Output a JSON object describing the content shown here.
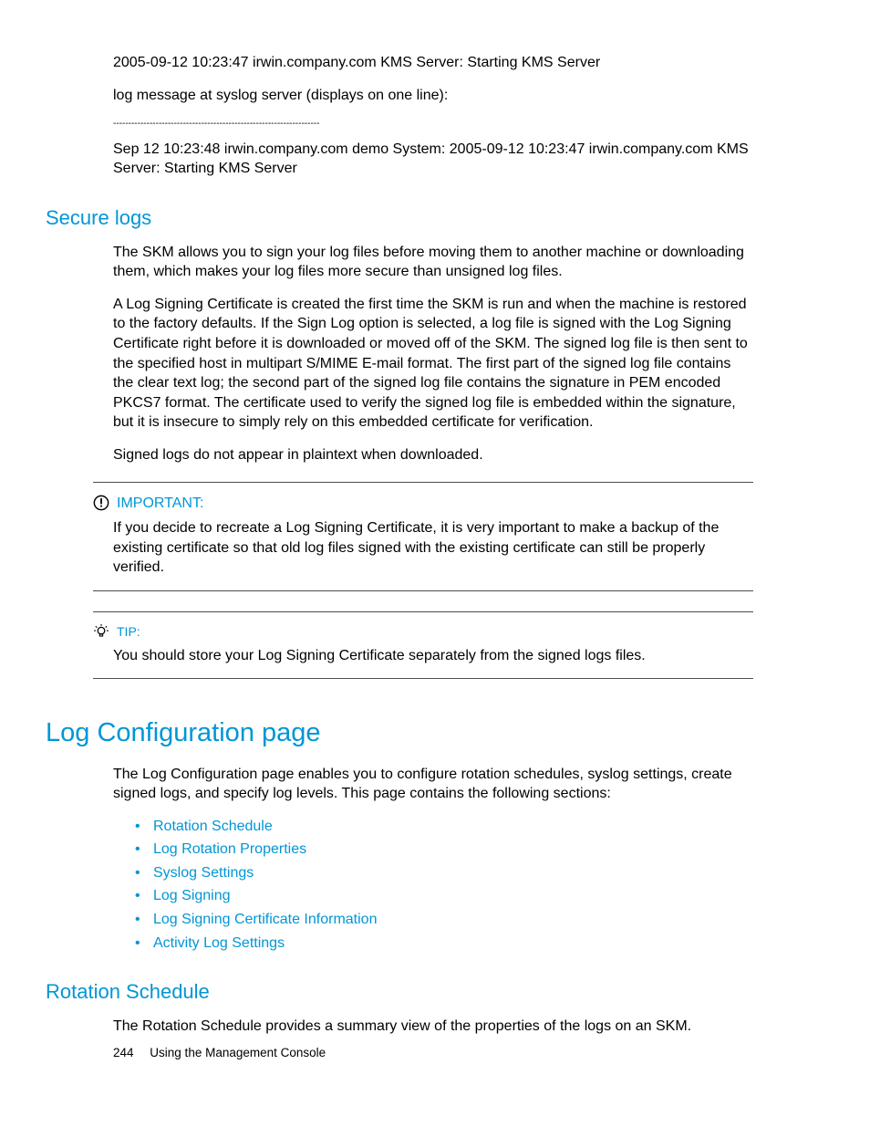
{
  "topBlock": {
    "line1": "2005-09-12 10:23:47 irwin.company.com KMS Server: Starting KMS Server",
    "line2": "log message at syslog server (displays on one line):",
    "sep": "--------------------------------------------------------------------",
    "line3": "Sep 12 10:23:48 irwin.company.com demo System: 2005-09-12 10:23:47 irwin.company.com KMS Server: Starting KMS Server"
  },
  "secureLogs": {
    "heading": "Secure logs",
    "p1": "The SKM allows you to sign your log files before moving them to another machine or downloading them, which makes your log files more secure than unsigned log files.",
    "p2": "A Log Signing Certificate is created the first time the SKM is run and when the machine is restored to the factory defaults. If the Sign Log option is selected, a log file is signed with the Log Signing Certificate right before it is downloaded or moved off of the SKM. The signed log file is then sent to the specified host in multipart  S/MIME E-mail format. The first part of the signed log file contains the clear text log; the second part of the signed log file contains the signature in PEM encoded PKCS7 format. The certificate used to verify the signed log file is embedded within the signature, but it is insecure to simply rely on this embedded certificate for verification.",
    "p3": "Signed logs do not appear in plaintext when downloaded."
  },
  "important": {
    "label": "IMPORTANT:",
    "body": "If you decide to recreate a Log Signing Certificate, it is very important to make a backup of the existing certificate so that old log files signed with the existing certificate can still be properly verified."
  },
  "tip": {
    "label": "TIP:",
    "body": "You should store your Log Signing Certificate separately from the signed logs files."
  },
  "logConfig": {
    "heading": "Log Configuration page",
    "intro": "The Log Configuration page enables you to configure rotation schedules, syslog settings, create signed logs, and specify log levels. This page contains the following sections:",
    "links": [
      "Rotation Schedule",
      "Log Rotation Properties",
      "Syslog Settings",
      "Log Signing",
      "Log Signing Certificate Information",
      "Activity Log Settings"
    ]
  },
  "rotation": {
    "heading": "Rotation Schedule",
    "body": "The Rotation Schedule provides a summary view of the properties of the logs on an SKM."
  },
  "footer": {
    "page": "244",
    "title": "Using the Management Console"
  }
}
